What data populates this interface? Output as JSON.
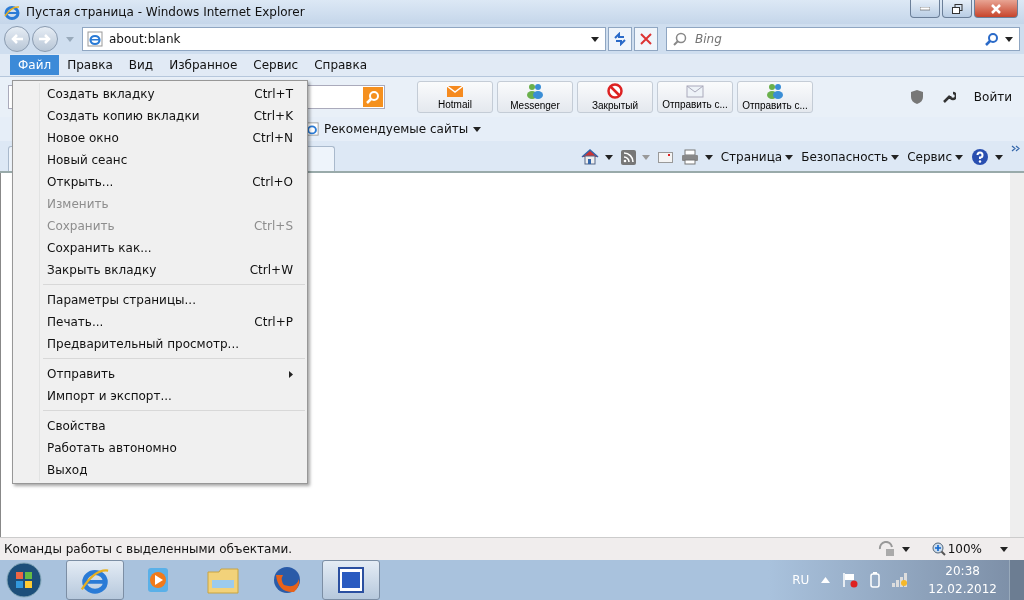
{
  "window": {
    "title": "Пустая страница - Windows Internet Explorer"
  },
  "address_bar": {
    "value": "about:blank"
  },
  "search": {
    "placeholder": "Bing"
  },
  "menu_bar": [
    {
      "label": "Файл",
      "selected": true
    },
    {
      "label": "Правка",
      "selected": false
    },
    {
      "label": "Вид",
      "selected": false
    },
    {
      "label": "Избранное",
      "selected": false
    },
    {
      "label": "Сервис",
      "selected": false
    },
    {
      "label": "Справка",
      "selected": false
    }
  ],
  "file_menu": [
    {
      "kind": "item",
      "label": "Создать вкладку",
      "shortcut": "Ctrl+T",
      "disabled": false
    },
    {
      "kind": "item",
      "label": "Создать копию вкладки",
      "shortcut": "Ctrl+K",
      "disabled": false
    },
    {
      "kind": "item",
      "label": "Новое окно",
      "shortcut": "Ctrl+N",
      "disabled": false
    },
    {
      "kind": "item",
      "label": "Новый сеанс",
      "disabled": false
    },
    {
      "kind": "item",
      "label": "Открыть...",
      "shortcut": "Ctrl+O",
      "disabled": false
    },
    {
      "kind": "item",
      "label": "Изменить",
      "disabled": true
    },
    {
      "kind": "item",
      "label": "Сохранить",
      "shortcut": "Ctrl+S",
      "disabled": true
    },
    {
      "kind": "item",
      "label": "Сохранить как...",
      "disabled": false
    },
    {
      "kind": "item",
      "label": "Закрыть вкладку",
      "shortcut": "Ctrl+W",
      "disabled": false
    },
    {
      "kind": "separator"
    },
    {
      "kind": "item",
      "label": "Параметры страницы...",
      "disabled": false
    },
    {
      "kind": "item",
      "label": "Печать...",
      "shortcut": "Ctrl+P",
      "disabled": false
    },
    {
      "kind": "item",
      "label": "Предварительный просмотр...",
      "disabled": false
    },
    {
      "kind": "separator"
    },
    {
      "kind": "submenu",
      "label": "Отправить",
      "disabled": false
    },
    {
      "kind": "item",
      "label": "Импорт и экспорт...",
      "disabled": false
    },
    {
      "kind": "separator"
    },
    {
      "kind": "item",
      "label": "Свойства",
      "disabled": false
    },
    {
      "kind": "item",
      "label": "Работать автономно",
      "disabled": false
    },
    {
      "kind": "item",
      "label": "Выход",
      "disabled": false
    }
  ],
  "toolbar_buttons": [
    {
      "kind": "mail",
      "label": "Hotmail"
    },
    {
      "kind": "people",
      "label": "Messenger"
    },
    {
      "kind": "block",
      "label": "Закрытый"
    },
    {
      "kind": "envelope",
      "label": "Отправить с..."
    },
    {
      "kind": "people",
      "label": "Отправить с..."
    }
  ],
  "sign_in": "Войти",
  "favorites_bar": {
    "link": "Рекомендуемые сайты"
  },
  "command_bar": [
    "Страница",
    "Безопасность",
    "Сервис"
  ],
  "status_bar": {
    "text": "Команды работы с выделенными объектами.",
    "zoom": "100%"
  },
  "taskbar": {
    "apps": [
      {
        "kind": "ie",
        "selected": true
      },
      {
        "kind": "media",
        "selected": false
      },
      {
        "kind": "folder",
        "selected": false
      },
      {
        "kind": "firefox",
        "selected": false
      },
      {
        "kind": "word",
        "selected": true
      }
    ],
    "language": "RU",
    "time": "20:38",
    "date": "12.02.2012"
  }
}
